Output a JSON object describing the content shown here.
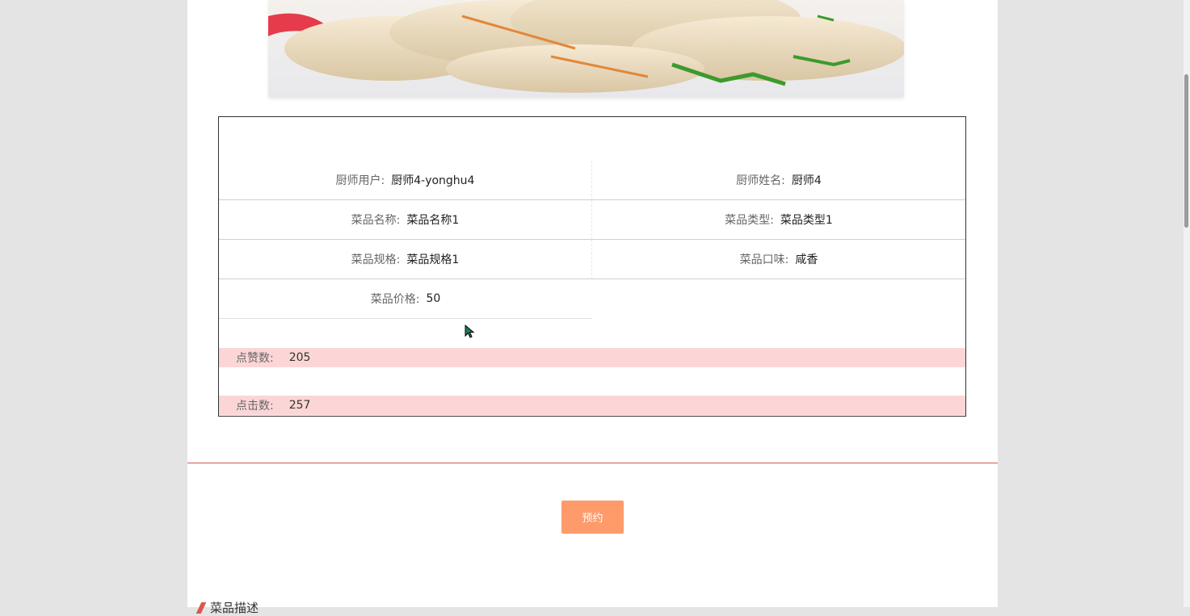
{
  "details": {
    "chef_user": {
      "label": "厨师用户:",
      "value": "厨师4-yonghu4"
    },
    "chef_name": {
      "label": "厨师姓名:",
      "value": "厨师4"
    },
    "dish_name": {
      "label": "菜品名称:",
      "value": "菜品名称1"
    },
    "dish_type": {
      "label": "菜品类型:",
      "value": "菜品类型1"
    },
    "dish_spec": {
      "label": "菜品规格:",
      "value": "菜品规格1"
    },
    "dish_taste": {
      "label": "菜品口味:",
      "value": "咸香"
    },
    "dish_price": {
      "label": "菜品价格:",
      "value": "50"
    },
    "likes": {
      "label": "点赞数:",
      "value": "205"
    },
    "clicks": {
      "label": "点击数:",
      "value": "257"
    }
  },
  "actions": {
    "book_label": "预约"
  },
  "section": {
    "description_title": "菜品描述"
  },
  "colors": {
    "accent": "#d9574c",
    "button": "#ff9a6a",
    "stat_bg": "#fcd6d6"
  }
}
